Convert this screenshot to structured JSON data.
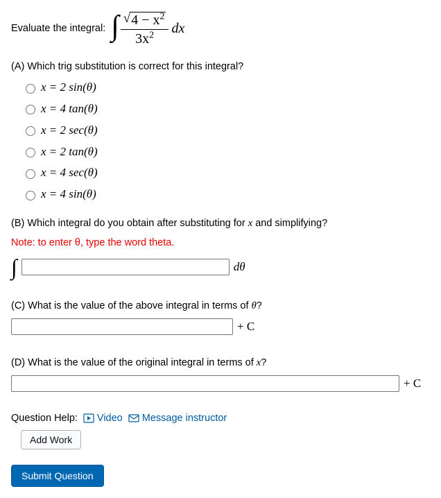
{
  "prompt": "Evaluate the integral:",
  "integral": {
    "sqrt_inner": "4 − x",
    "sqrt_exp": "2",
    "denominator": "3x",
    "denom_exp": "2",
    "dx": "dx"
  },
  "partA": {
    "label": "(A) Which trig substitution is correct for this integral?",
    "choices": [
      "x = 2 sin(θ)",
      "x = 4 tan(θ)",
      "x = 2 sec(θ)",
      "x = 2 tan(θ)",
      "x = 4 sec(θ)",
      "x = 4 sin(θ)"
    ]
  },
  "partB": {
    "label": "(B) Which integral do you obtain after substituting for x and simplifying?",
    "note": "Note: to enter θ, type the word theta.",
    "after": "dθ",
    "value": ""
  },
  "partC": {
    "label": "(C) What is the value of the above integral in terms of θ?",
    "after": "+ C",
    "value": ""
  },
  "partD": {
    "label": "(D) What is the value of the original integral in terms of x?",
    "after": "+ C",
    "value": ""
  },
  "help": {
    "label": "Question Help:",
    "video": "Video",
    "message": "Message instructor",
    "addwork": "Add Work"
  },
  "submit": "Submit Question"
}
